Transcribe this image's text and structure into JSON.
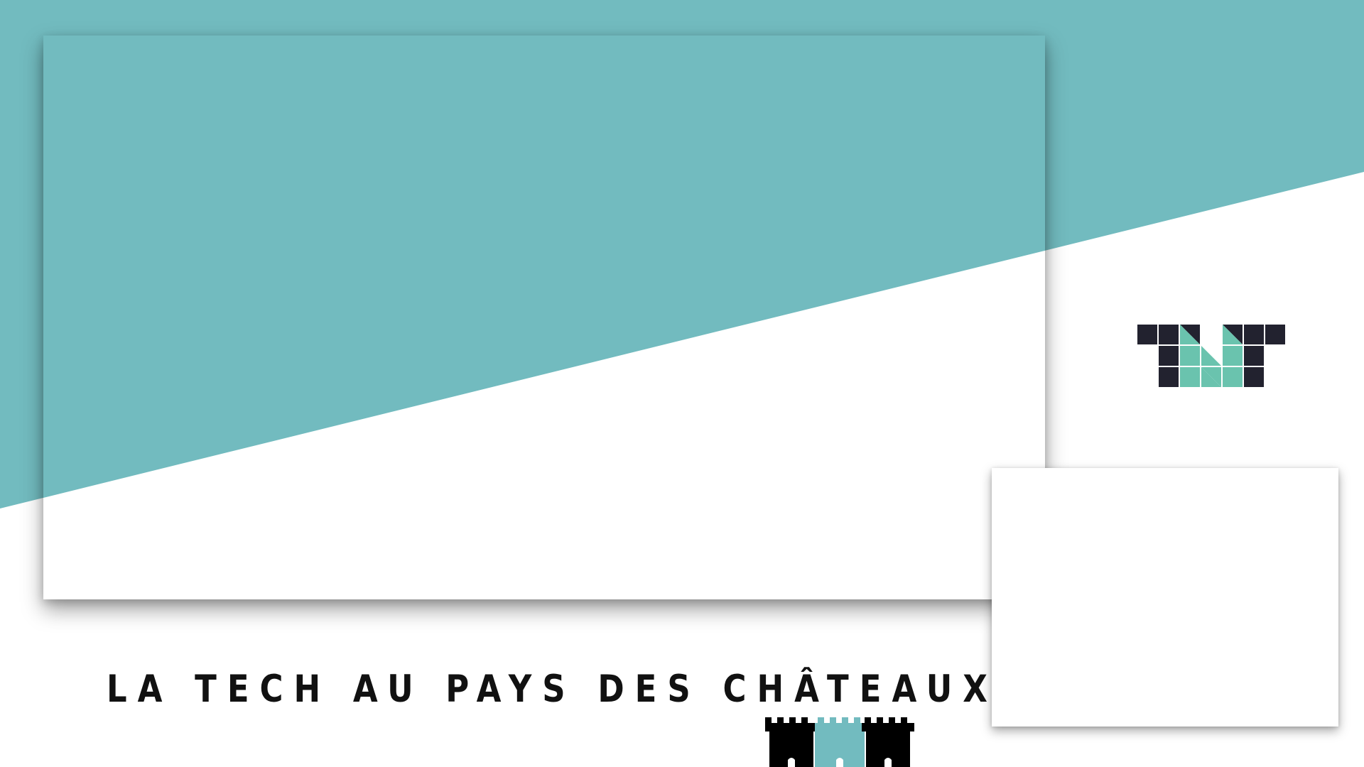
{
  "colors": {
    "accent_teal": "#72bbbf",
    "logo_dark": "#22222f",
    "logo_green": "#6ac3ae",
    "castle_dark": "#000000",
    "background": "#ffffff"
  },
  "title": {
    "text": "LA TECH AU PAYS DES CHÂTEAUX"
  },
  "logos": {
    "brand_icon": "tnt-pixel-logo",
    "castle_icon": "castle-towers-logo"
  }
}
